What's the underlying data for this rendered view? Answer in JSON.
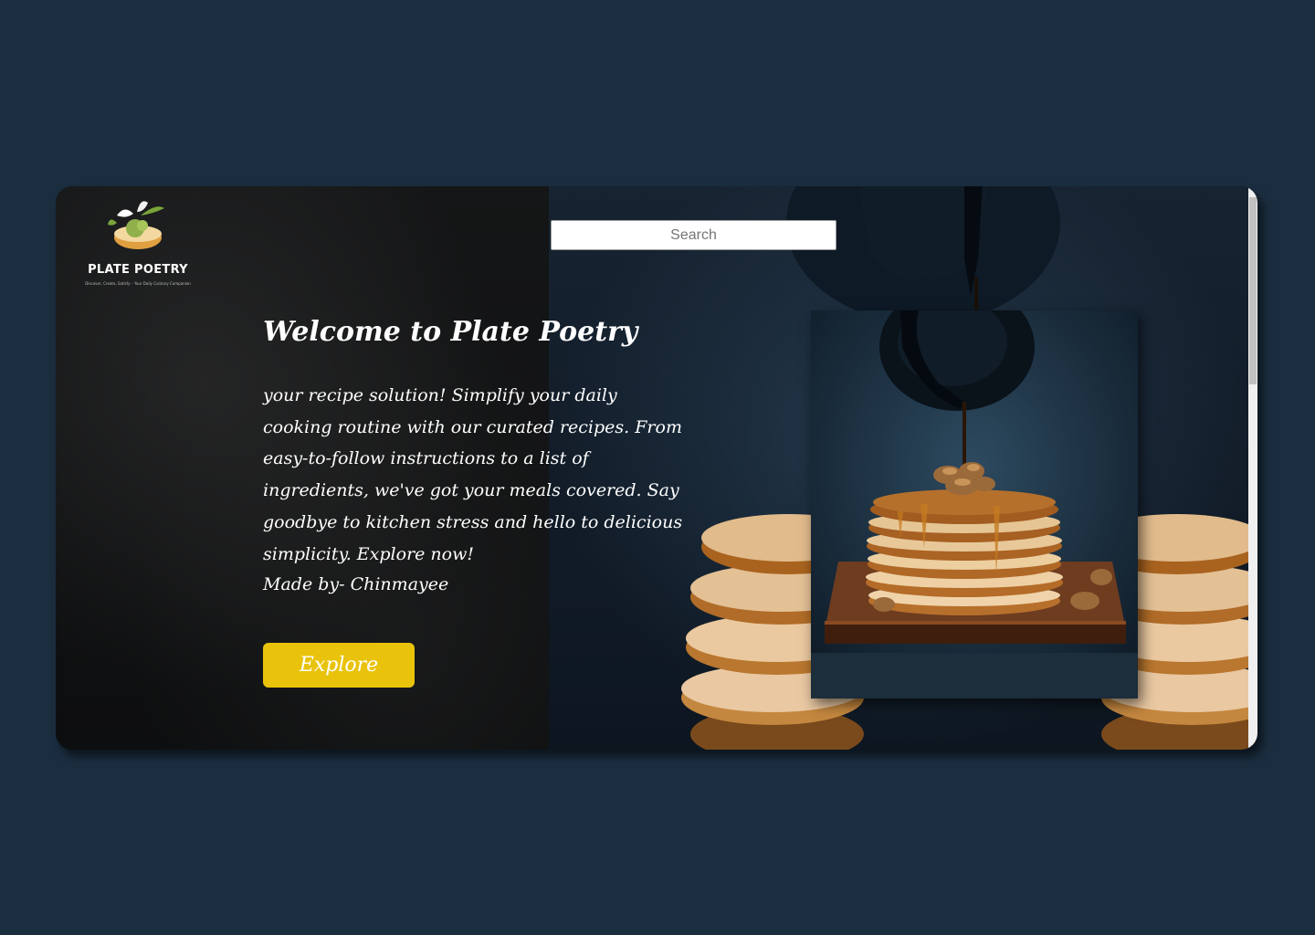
{
  "brand": {
    "name": "PLATE POETRY",
    "tagline": "Discover, Create, Satisfy – Your Daily Culinary Companion"
  },
  "search": {
    "placeholder": "Search"
  },
  "hero": {
    "title": "Welcome to Plate Poetry",
    "description": "your recipe solution! Simplify your daily cooking routine with our curated recipes. From easy-to-follow instructions to a list of ingredients, we've got your meals covered. Say goodbye to kitchen stress and hello to delicious simplicity. Explore now!",
    "credit": "Made by- Chinmayee",
    "button_label": "Explore"
  },
  "colors": {
    "page_background": "#1b2e40",
    "button": "#e9c30b",
    "text": "#ffffff"
  }
}
